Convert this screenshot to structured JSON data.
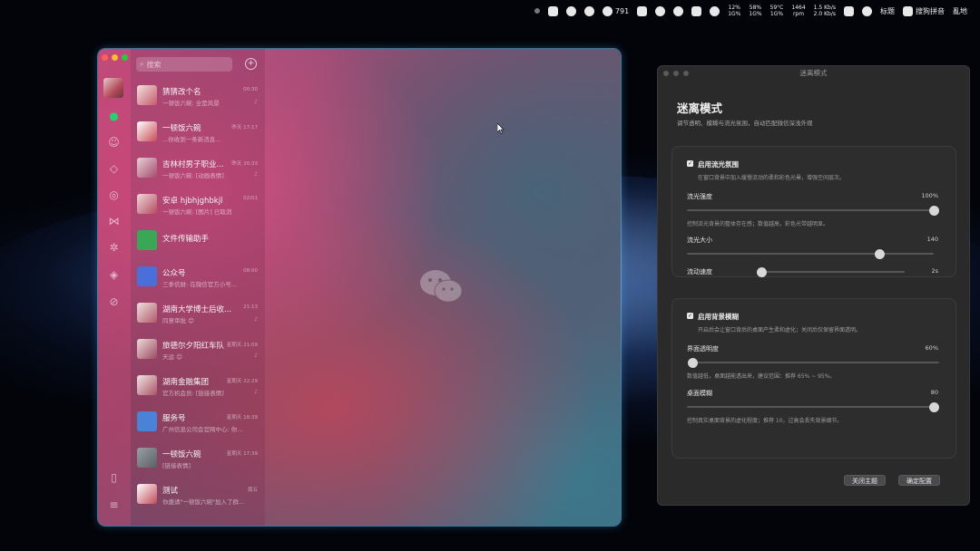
{
  "menubar": {
    "cpu_label": "791",
    "stats": [
      {
        "top": "12%",
        "bottom": "1G%"
      },
      {
        "top": "58%",
        "bottom": "1G%"
      },
      {
        "top": "59°C",
        "bottom": "1G%"
      },
      {
        "top": "1464",
        "bottom": "rpm"
      },
      {
        "top": "1.5 Kb/s",
        "bottom": "2.0 Kb/s"
      }
    ],
    "status_text": "标题",
    "input_method": "搜狗拼音",
    "user": "亂地"
  },
  "wechat": {
    "search_placeholder": "搜索",
    "chats": [
      {
        "name": "猜猜改个名",
        "time": "00:30",
        "preview": "一顿饭六碗: 全是风景"
      },
      {
        "name": "一顿饭六碗",
        "time": "昨天 17:17",
        "preview": "...你收到一条新消息..."
      },
      {
        "name": "吉林村男子职业...",
        "time": "昨天 20:33",
        "preview": "一顿饭六碗: [动画表情]"
      },
      {
        "name": "安卓 hjbhjghbkjl",
        "time": "02/01",
        "preview": "一顿饭六碗: [图片] 已取消"
      },
      {
        "name": "文件传输助手",
        "time": "",
        "preview": ""
      },
      {
        "name": "公众号",
        "time": "08:00",
        "preview": "三季信财: 在微信官方小号..."
      },
      {
        "name": "湖南大学博士后收...",
        "time": "21:13",
        "preview": "同意审批 😊"
      },
      {
        "name": "旅德尔夕阳红车队",
        "time": "星期天 21:09",
        "preview": "天运 😊"
      },
      {
        "name": "湖南金融集团",
        "time": "星期天 22:29",
        "preview": "官方机会员: [链接表情]"
      },
      {
        "name": "服务号",
        "time": "星期天 18:39",
        "preview": "广州信息公司会官网中心: 你..."
      },
      {
        "name": "一顿饭六碗",
        "time": "星期天 17:39",
        "preview": "[链接表情]"
      },
      {
        "name": "测试",
        "time": "周五",
        "preview": "你邀请\"一顿饭六碗\"加入了群..."
      }
    ]
  },
  "panel": {
    "window_title": "迷离模式",
    "heading": "迷离模式",
    "subtitle": "调节透明、模糊与流光氛围，自动匹配微信深浅外观",
    "section1": {
      "title": "启用流光氛围",
      "desc": "在窗口背景中加入缓慢流动的柔和彩色光晕，增强空间层次。",
      "intensity_label": "流光强度",
      "intensity_value": "100%",
      "intensity_fraction": 1.0,
      "intensity_desc": "控制流光背景的整体存在感；数值越高，彩色光带越明显。",
      "size_label": "流光大小",
      "size_value": "140",
      "size_fraction": 0.78,
      "speed_label": "流动速度",
      "speed_value": "2s",
      "speed_fraction": 0.0
    },
    "section2": {
      "title": "启用背景模糊",
      "desc": "开启后会让窗口背后的桌面产生柔和虚化；关闭后仅保留界面透明。",
      "opacity_label": "界面透明度",
      "opacity_value": "60%",
      "opacity_fraction": 0.0,
      "opacity_desc": "数值越低，桌面越能透出来，建议范围：推荐 65% ~ 95%。",
      "blur_label": "桌面模糊",
      "blur_value": "80",
      "blur_fraction": 1.0,
      "blur_desc": "控制真实桌面背景的虚化程度；推荐 10，过高会丢失背景细节。"
    },
    "close_button": "关闭主题",
    "confirm_button": "确定配置"
  }
}
